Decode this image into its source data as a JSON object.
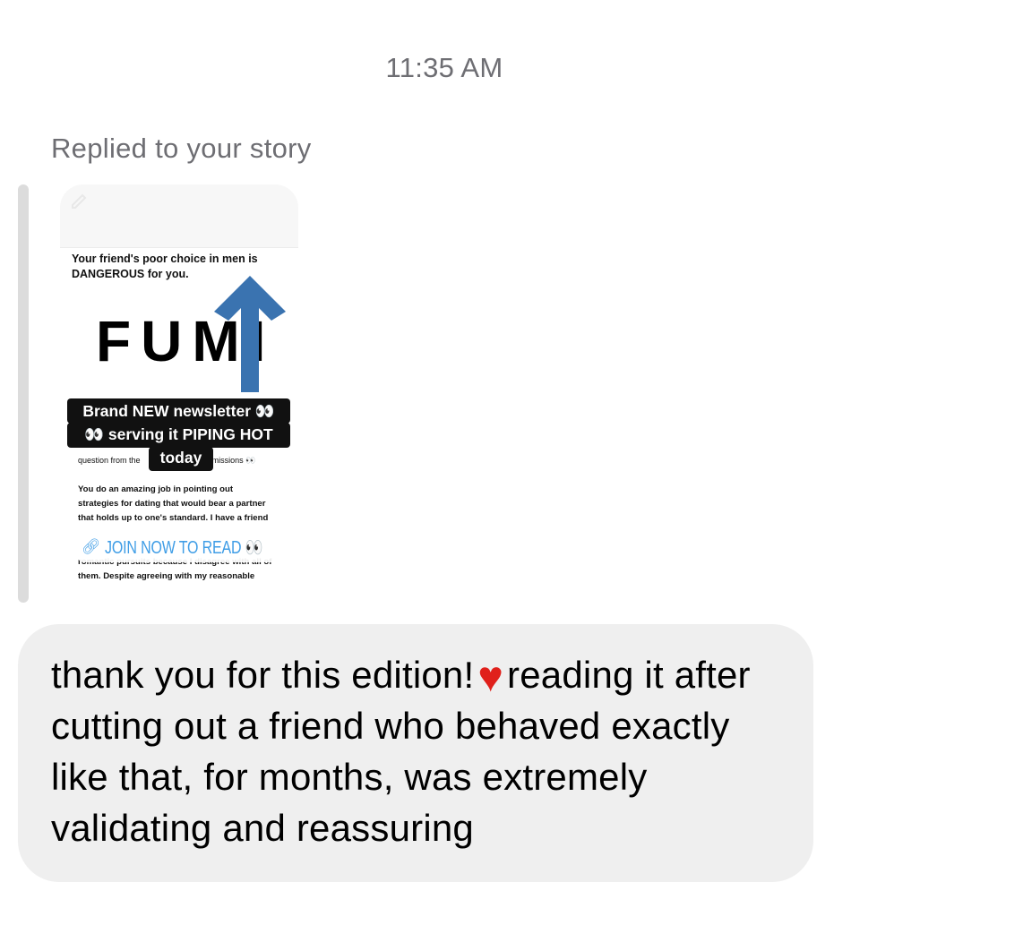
{
  "thread": {
    "timestamp": "11:35 AM",
    "reply_context_label": "Replied to your story"
  },
  "story": {
    "headline": "Your friend's poor choice in men is DANGEROUS for you.",
    "logo_text": "FUMI",
    "stickers": [
      "Brand NEW newsletter 👀",
      "👀 serving it PIPING HOT",
      "today"
    ],
    "small_text_left": "question from the",
    "small_text_right": "missions 👀",
    "body_lines": [
      "You do an amazing job in pointing out",
      "strategies for dating that would bear a partner",
      "that holds up to one's standard. I have a friend",
      "romantic pursuits because I disagree with all of",
      "them. Despite agreeing with my reasonable"
    ],
    "link_sticker_label": "JOIN NOW TO READ 👀",
    "icons": {
      "pencil": "pencil-icon",
      "arrow": "arrow-up-icon",
      "link": "link-icon"
    },
    "arrow_color": "#3a73b0",
    "link_color": "#3f9de6"
  },
  "message": {
    "text_before_heart": "thank you for this edition!",
    "heart_icon": "heart-icon",
    "text_after_heart": "reading it after cutting out a friend who behaved exactly like that, for months, was extremely validating and reassuring",
    "bubble_color": "#efefef"
  }
}
